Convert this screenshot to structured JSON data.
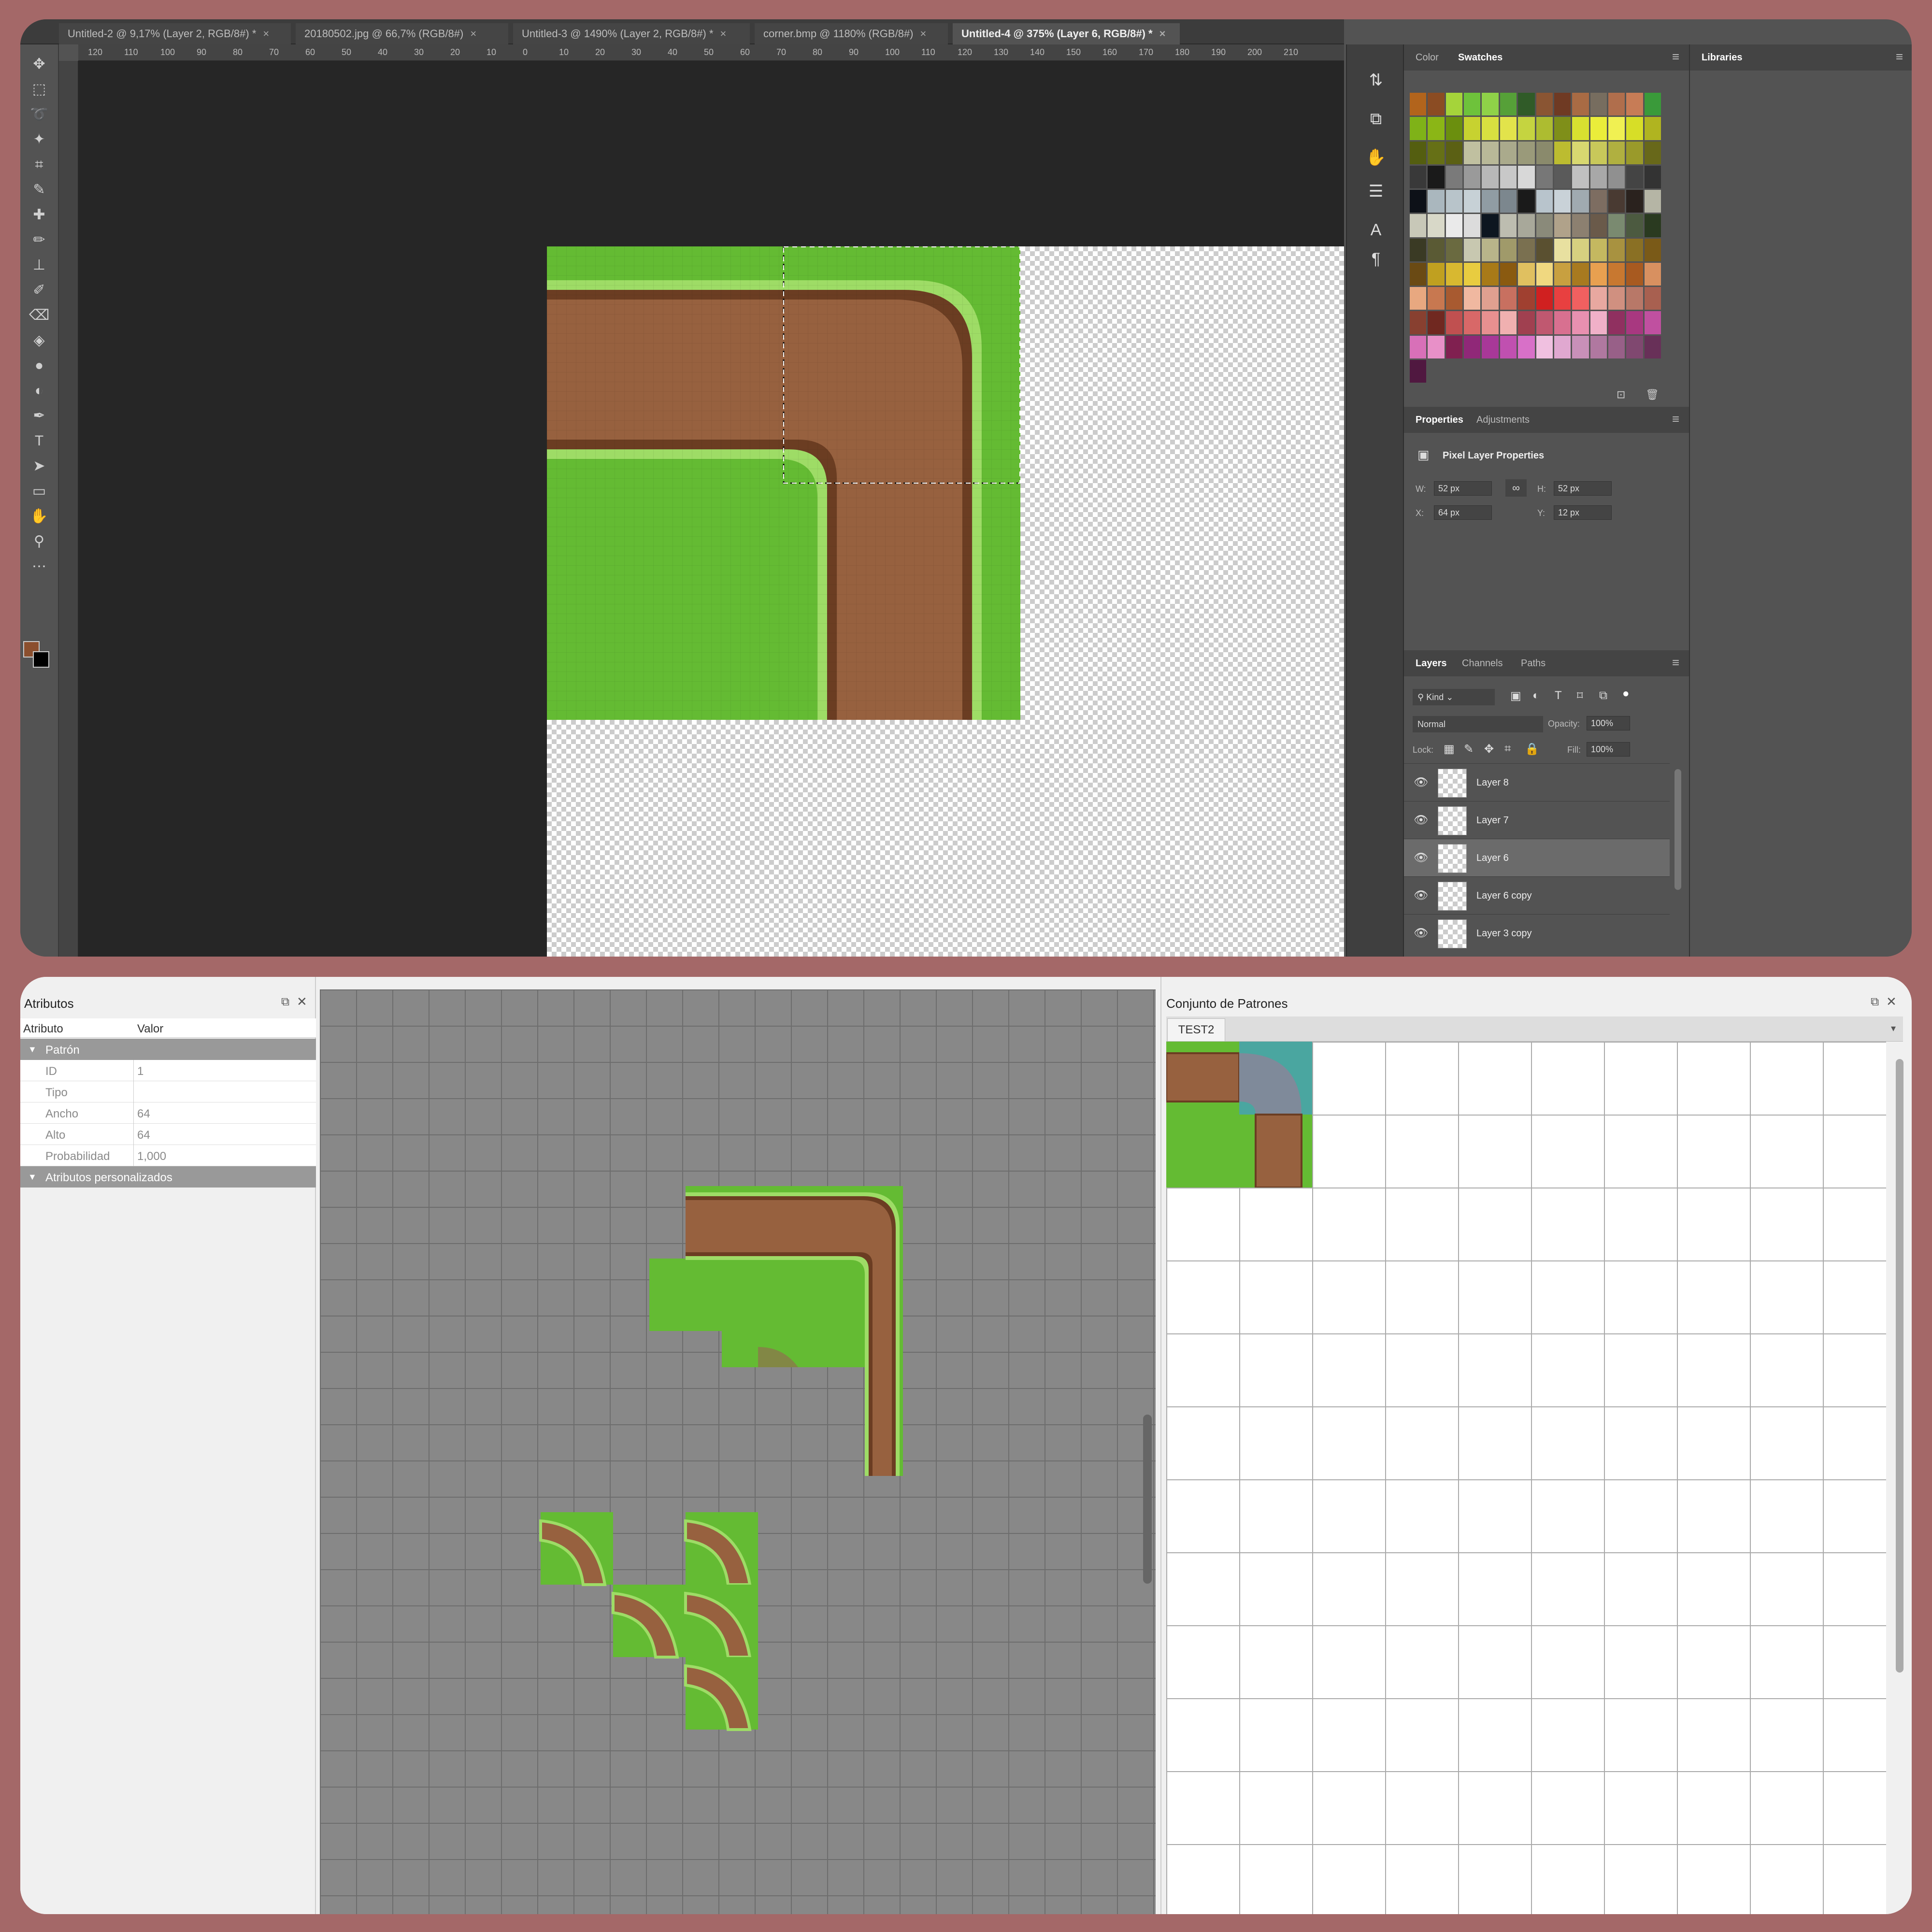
{
  "photoshop": {
    "tabs": [
      {
        "label": "Untitled-2 @ 9,17% (Layer 2, RGB/8#) *"
      },
      {
        "label": "20180502.jpg @ 66,7% (RGB/8#)"
      },
      {
        "label": "Untitled-3 @ 1490% (Layer 2, RGB/8#) *"
      },
      {
        "label": "corner.bmp @ 1180% (RGB/8#)"
      },
      {
        "label": "Untitled-4 @ 375% (Layer 6, RGB/8#) *"
      }
    ],
    "tab_close": "×",
    "ruler_ticks": [
      "120",
      "110",
      "100",
      "90",
      "80",
      "70",
      "60",
      "50",
      "40",
      "30",
      "20",
      "10",
      "0",
      "10",
      "20",
      "30",
      "40",
      "50",
      "60",
      "70",
      "80",
      "90",
      "100",
      "110",
      "120",
      "130",
      "140",
      "150",
      "160",
      "170",
      "180",
      "190",
      "200",
      "210"
    ],
    "tools": [
      "move-icon",
      "marquee-icon",
      "lasso-icon",
      "magic-wand-icon",
      "crop-icon",
      "eyedropper-icon",
      "healing-icon",
      "pencil-icon",
      "stamp-icon",
      "history-brush-icon",
      "eraser-icon",
      "bucket-icon",
      "blur-icon",
      "dodge-icon",
      "pen-icon",
      "type-icon",
      "path-select-icon",
      "rectangle-icon",
      "hand-icon",
      "zoom-icon",
      "more-icon"
    ],
    "tool_glyphs": [
      "✥",
      "⬚",
      "➰",
      "✦",
      "⌗",
      "✎",
      "✚",
      "✏",
      "⊥",
      "✐",
      "⌫",
      "◈",
      "●",
      "◐",
      "✒",
      "T",
      "➤",
      "▭",
      "✋",
      "⚲",
      "⋯"
    ],
    "fg_color": "#8b4f2e",
    "panels": {
      "color_tab": "Color",
      "swatches_tab": "Swatches",
      "libraries_tab": "Libraries",
      "properties_tab": "Properties",
      "adjustments_tab": "Adjustments",
      "pixel_layer_title": "Pixel Layer Properties",
      "w_label": "W:",
      "w_value": "52 px",
      "h_label": "H:",
      "h_value": "52 px",
      "x_label": "X:",
      "x_value": "64 px",
      "y_label": "Y:",
      "y_value": "12 px",
      "layers_tab": "Layers",
      "channels_tab": "Channels",
      "paths_tab": "Paths",
      "kind_label": "Kind",
      "blend_mode": "Normal",
      "opacity_label": "Opacity:",
      "opacity_value": "100%",
      "lock_label": "Lock:",
      "fill_label": "Fill:",
      "fill_value": "100%"
    },
    "layers": [
      {
        "name": "Layer 8",
        "selected": false
      },
      {
        "name": "Layer 7",
        "selected": false
      },
      {
        "name": "Layer 6",
        "selected": true
      },
      {
        "name": "Layer 6 copy",
        "selected": false
      },
      {
        "name": "Layer 3 copy",
        "selected": false
      }
    ],
    "swatch_colors": [
      "#b2641c",
      "#8b4c23",
      "#a5d43a",
      "#6ec23b",
      "#8fd248",
      "#56a038",
      "#305b28",
      "#8a5533",
      "#6f3a23",
      "#a96b44",
      "#776d5f",
      "#b06e4c",
      "#c77c56",
      "#3a9a3a",
      "#7fb218",
      "#8bb616",
      "#6b8f0e",
      "#c7d230",
      "#d8e040",
      "#e2e34b",
      "#c5d440",
      "#adbc30",
      "#7f8f19",
      "#d8e030",
      "#eaed3a",
      "#f0f052",
      "#d7de27",
      "#b0b420",
      "#545e10",
      "#667016",
      "#5b6014",
      "#c0c0a0",
      "#b8b898",
      "#aaaa8c",
      "#9a9a7a",
      "#8a8a6c",
      "#bcbc30",
      "#d8d870",
      "#c8c85a",
      "#b0b040",
      "#9a9a2a",
      "#68681a",
      "#393939",
      "#1a1a1a",
      "#7a7a7a",
      "#9a9a9a",
      "#b8b8b8",
      "#c8c8c8",
      "#d8d8d8",
      "#777777",
      "#5a5a5a",
      "#c0c0c0",
      "#a8a8a8",
      "#909090",
      "#444",
      "#333",
      "#0d1118",
      "#aab7be",
      "#b8c4ca",
      "#c7d1d6",
      "#909ca3",
      "#7c878e",
      "#1a1a1a",
      "#b8c4cc",
      "#c9d2d8",
      "#a0aab0",
      "#7d6d61",
      "#493a32",
      "#2a221e",
      "#b5b5a5",
      "#c8c8b8",
      "#d8d8c8",
      "#eaeaea",
      "#dcdcdc",
      "#0d1620",
      "#bdbdb0",
      "#a8a89a",
      "#8a8a7a",
      "#b0a28a",
      "#8c8070",
      "#6a5a4a",
      "#7a8a70",
      "#4c5a40",
      "#2a3a20",
      "#3a3a24",
      "#5a5a34",
      "#6a6a40",
      "#c8c8b0",
      "#b8b48a",
      "#a09a6a",
      "#7a7050",
      "#5a5030",
      "#e8e0a0",
      "#d6d080",
      "#c4b860",
      "#a89240",
      "#8a7024",
      "#7a5a18",
      "#6a4a14",
      "#c0a020",
      "#d8b830",
      "#e8cc40",
      "#a87a18",
      "#8a5a10",
      "#e0c060",
      "#f0d880",
      "#c8a040",
      "#a87a20",
      "#e8a050",
      "#c87830",
      "#a85a20",
      "#d89060",
      "#e8a880",
      "#c87850",
      "#a85a30",
      "#f0b8a0",
      "#e0a090",
      "#c87060",
      "#a04030",
      "#d02020",
      "#e84040",
      "#f06060",
      "#e8a8a0",
      "#d09080",
      "#b87868",
      "#a86050",
      "#884030",
      "#702820",
      "#c05050",
      "#d86868",
      "#e89090",
      "#f0b0b0",
      "#a04050",
      "#c05870",
      "#d87090",
      "#e890b0",
      "#f0b0c8",
      "#903060",
      "#a83880",
      "#c050a0",
      "#d870b8",
      "#e890c8",
      "#802050",
      "#902878",
      "#a83898",
      "#c050b0",
      "#d870c8",
      "#f0c0e0",
      "#e0a8d0",
      "#c890b8",
      "#b078a0",
      "#986088",
      "#804870",
      "#683058",
      "#501840"
    ]
  },
  "tiled": {
    "attributes_title": "Atributos",
    "col_attr": "Atributo",
    "col_value": "Valor",
    "group_pattern": "Patrón",
    "rows": [
      {
        "key": "ID",
        "value": "1"
      },
      {
        "key": "Tipo",
        "value": ""
      },
      {
        "key": "Ancho",
        "value": "64"
      },
      {
        "key": "Alto",
        "value": "64"
      },
      {
        "key": "Probabilidad",
        "value": "1,000"
      }
    ],
    "group_custom": "Atributos personalizados",
    "tileset_title": "Conjunto de Patrones",
    "tileset_tab": "TEST2"
  },
  "colors": {
    "grass": "#64bb33",
    "grass_light": "#9edc66",
    "dirt": "#97613f",
    "dirt_dark": "#6b3d22"
  }
}
